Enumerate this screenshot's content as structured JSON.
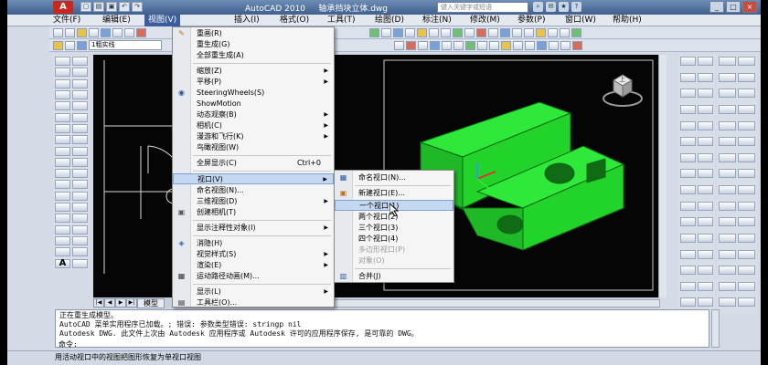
{
  "window": {
    "app_logo": "A",
    "title": "AutoCAD 2010",
    "filename": "轴承挡块立体.dwg",
    "search_placeholder": "键入关键字或短语",
    "controls": [
      "_",
      "□",
      "×"
    ]
  },
  "menubar": {
    "items": [
      "文件(F)",
      "编辑(E)",
      "视图(V)",
      "插入(I)",
      "格式(O)",
      "工具(T)",
      "绘图(D)",
      "标注(N)",
      "修改(M)",
      "参数(P)",
      "窗口(W)",
      "帮助(H)"
    ],
    "active_index": 2
  },
  "layer_toolbar": {
    "current_layer": "1粗实线"
  },
  "view_menu": {
    "items": [
      {
        "label": "重画(R)",
        "icon": "pencil-icon",
        "arrow": false
      },
      {
        "label": "重生成(G)",
        "icon": "",
        "arrow": false
      },
      {
        "label": "全部重生成(A)",
        "icon": "",
        "arrow": false
      },
      {
        "label": "缩放(Z)",
        "icon": "",
        "arrow": true
      },
      {
        "label": "平移(P)",
        "icon": "",
        "arrow": true
      },
      {
        "label": "SteeringWheels(S)",
        "icon": "steering-wheel-icon",
        "arrow": false
      },
      {
        "label": "ShowMotion",
        "icon": "",
        "arrow": false
      },
      {
        "label": "动态观察(B)",
        "icon": "",
        "arrow": true
      },
      {
        "label": "相机(C)",
        "icon": "",
        "arrow": true
      },
      {
        "label": "漫游和飞行(K)",
        "icon": "",
        "arrow": true
      },
      {
        "label": "鸟瞰视图(W)",
        "icon": "",
        "arrow": false
      },
      {
        "label": "全屏显示(C)",
        "icon": "",
        "arrow": false,
        "shortcut": "Ctrl+0"
      },
      {
        "label": "视口(V)",
        "icon": "",
        "arrow": true
      },
      {
        "label": "命名视图(N)...",
        "icon": "",
        "arrow": false
      },
      {
        "label": "三维视图(D)",
        "icon": "",
        "arrow": true
      },
      {
        "label": "创建相机(T)",
        "icon": "camera-icon",
        "arrow": false
      },
      {
        "label": "显示注释性对象(I)",
        "icon": "",
        "arrow": true
      },
      {
        "label": "消隐(H)",
        "icon": "hide-icon",
        "arrow": false
      },
      {
        "label": "视觉样式(S)",
        "icon": "",
        "arrow": true
      },
      {
        "label": "渲染(E)",
        "icon": "",
        "arrow": true
      },
      {
        "label": "运动路径动画(M)...",
        "icon": "film-icon",
        "arrow": false
      },
      {
        "label": "显示(L)",
        "icon": "",
        "arrow": true
      },
      {
        "label": "工具栏(O)...",
        "icon": "toolbar-icon",
        "arrow": false
      }
    ]
  },
  "viewport_menu": {
    "items": [
      {
        "label": "命名视口(N)...",
        "icon": "named-viewports-icon"
      },
      {
        "label": "新建视口(E)...",
        "icon": "new-viewport-icon"
      },
      {
        "label": "一个视口(1)",
        "icon": ""
      },
      {
        "label": "两个视口(2)",
        "icon": ""
      },
      {
        "label": "三个视口(3)",
        "icon": ""
      },
      {
        "label": "四个视口(4)",
        "icon": ""
      },
      {
        "label": "多边形视口(P)",
        "icon": "",
        "disabled": true
      },
      {
        "label": "对象(O)",
        "icon": "",
        "disabled": true
      },
      {
        "label": "合并(J)",
        "icon": "join-icon"
      }
    ]
  },
  "layout_tabs": {
    "model": "模型",
    "nav": [
      "|◀",
      "◀",
      "▶",
      "▶|"
    ]
  },
  "viewcube_label": "上",
  "command": {
    "lines": [
      "正在重生成模型。",
      "AutoCAD 菜单实用程序已加载。; 错误: 参数类型错误: stringp nil",
      "Autodesk DWG.  此文件上次由 Autodesk 应用程序或 Autodesk 许可的应用程序保存, 是可靠的 DWG。"
    ],
    "prompt": "命令:"
  },
  "status": {
    "text": "用活动视口中的视图把图形恢复为单视口视图"
  },
  "colors": {
    "part_green": "#22d42a",
    "menu_highlight": "#c5d8f1",
    "title_bar": "#4a6a98"
  }
}
